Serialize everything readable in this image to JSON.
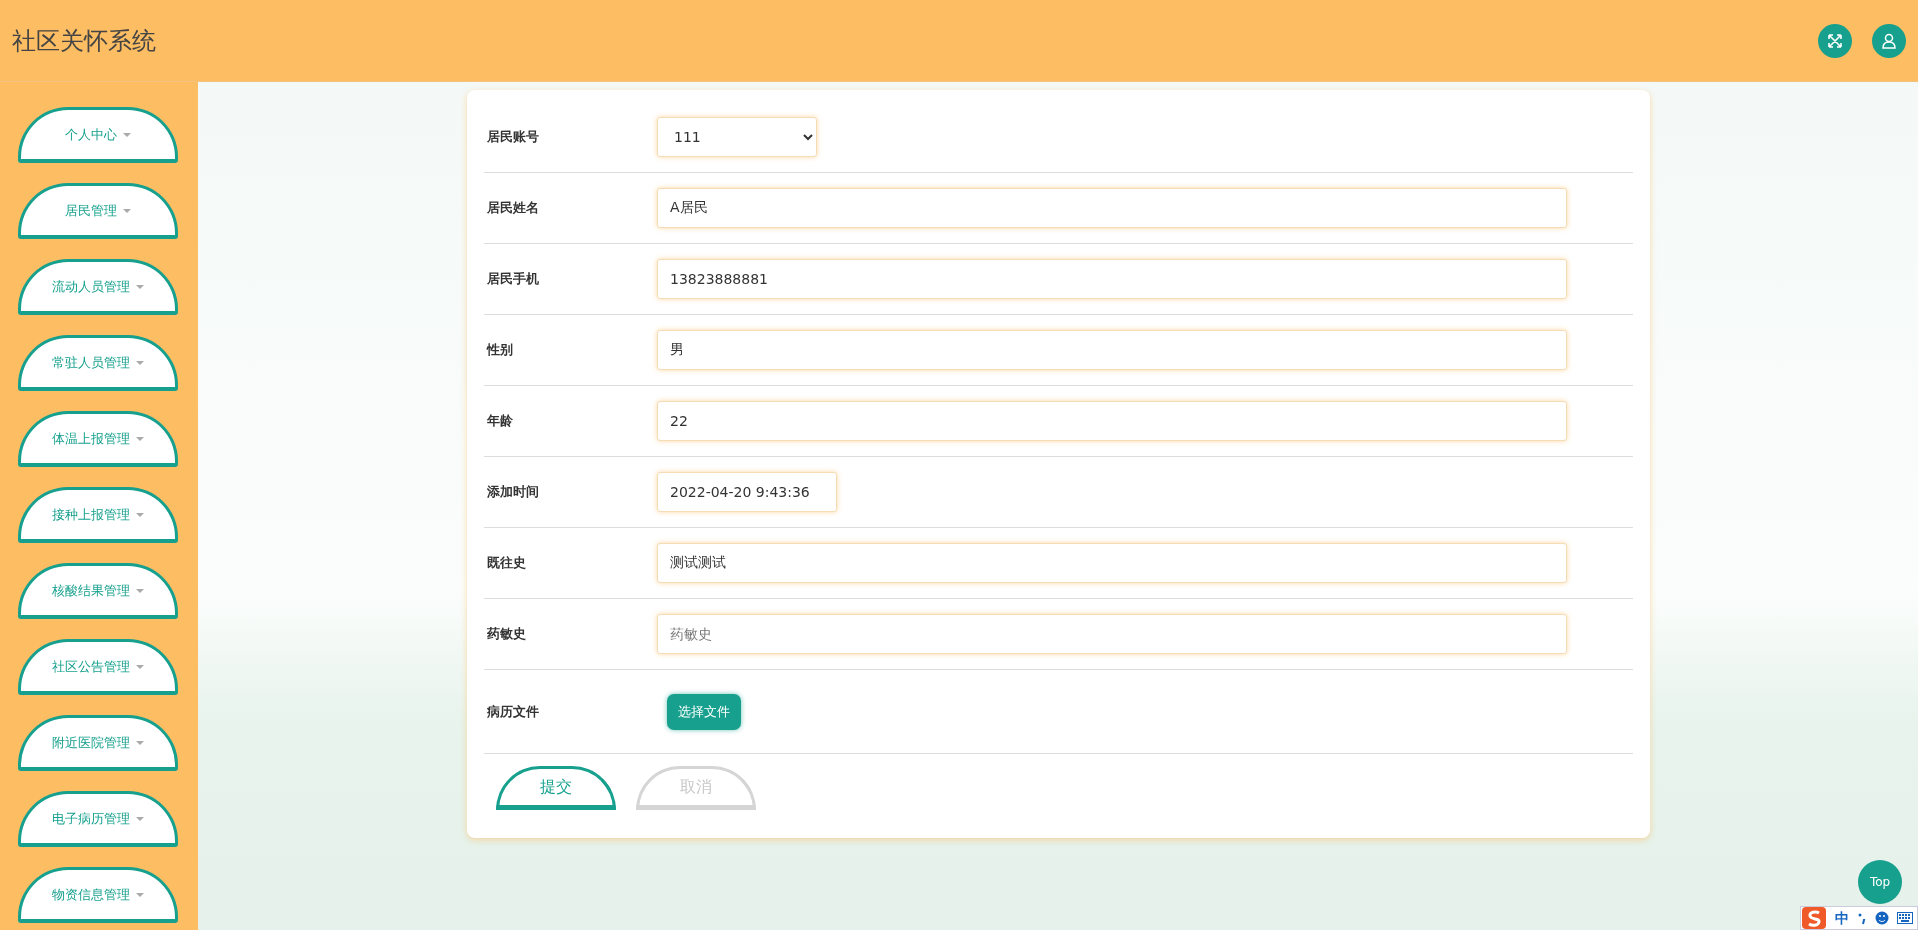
{
  "header": {
    "title": "社区关怀系统"
  },
  "sidebar": {
    "items": [
      {
        "label": "个人中心"
      },
      {
        "label": "居民管理"
      },
      {
        "label": "流动人员管理"
      },
      {
        "label": "常驻人员管理"
      },
      {
        "label": "体温上报管理"
      },
      {
        "label": "接种上报管理"
      },
      {
        "label": "核酸结果管理"
      },
      {
        "label": "社区公告管理"
      },
      {
        "label": "附近医院管理"
      },
      {
        "label": "电子病历管理"
      },
      {
        "label": "物资信息管理"
      }
    ]
  },
  "form": {
    "fields": [
      {
        "kind": "select",
        "label": "居民账号",
        "value": "111"
      },
      {
        "kind": "text",
        "label": "居民姓名",
        "value": "A居民"
      },
      {
        "kind": "text",
        "label": "居民手机",
        "value": "13823888881"
      },
      {
        "kind": "text",
        "label": "性别",
        "value": "男"
      },
      {
        "kind": "text",
        "label": "年龄",
        "value": "22"
      },
      {
        "kind": "date",
        "label": "添加时间",
        "value": "2022-04-20 9:43:36"
      },
      {
        "kind": "text",
        "label": "既往史",
        "value": "测试测试"
      },
      {
        "kind": "text",
        "label": "药敏史",
        "placeholder": "药敏史"
      },
      {
        "kind": "file",
        "label": "病历文件",
        "button": "选择文件"
      }
    ],
    "buttons": [
      {
        "kind": "submit",
        "label": "提交"
      },
      {
        "kind": "cancel",
        "label": "取消"
      }
    ]
  },
  "top_button": {
    "label": "Top"
  },
  "ime_toolbar": {
    "mode": "中"
  }
}
